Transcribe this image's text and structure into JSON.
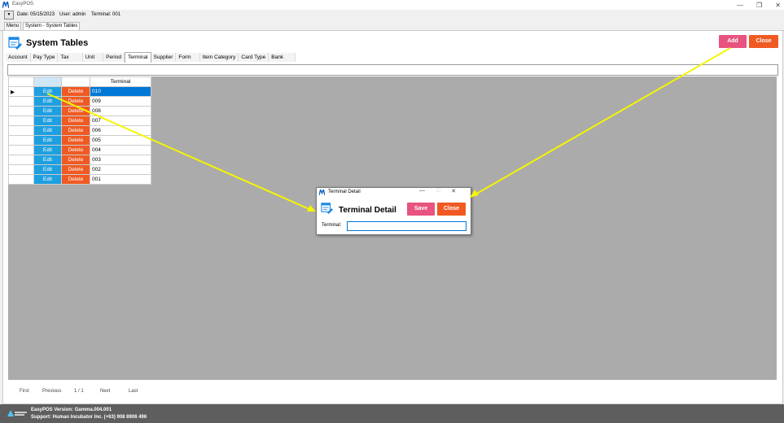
{
  "app": {
    "title": "EasyPOS"
  },
  "infobar": {
    "date": "Date: 05/15/2023",
    "user": "User: admin",
    "terminal": "Terminal: 001"
  },
  "doc_tabs": [
    "Menu",
    "System - System Tables"
  ],
  "page": {
    "title": "System Tables",
    "add_label": "Add",
    "close_label": "Close"
  },
  "tabs": [
    "Account",
    "Pay Type",
    "Tax",
    "Unit",
    "Period",
    "Terminal",
    "Supplier",
    "Form",
    "Item Category",
    "Card Type",
    "Bank"
  ],
  "active_tab": "Terminal",
  "table": {
    "header": "Terminal",
    "edit_label": "Edit",
    "delete_label": "Delete",
    "rows": [
      "010",
      "009",
      "008",
      "007",
      "006",
      "005",
      "004",
      "003",
      "002",
      "001"
    ]
  },
  "pager": {
    "first": "First",
    "previous": "Previous",
    "page": "1 / 1",
    "next": "Next",
    "last": "Last"
  },
  "status": {
    "version": "EasyPOS Version: Gamma.004.001",
    "support": "Support: Human Incubator Inc. (+63) 908 8906 496"
  },
  "dialog": {
    "window_title": "Terminal Detail",
    "heading": "Terminal Detail",
    "save_label": "Save",
    "close_label": "Close",
    "field_label": "Terminal:",
    "field_value": ""
  },
  "colors": {
    "pink": "#e8537f",
    "orange": "#f05a22",
    "blue": "#1e9fe0",
    "annotation": "#f5f500"
  }
}
